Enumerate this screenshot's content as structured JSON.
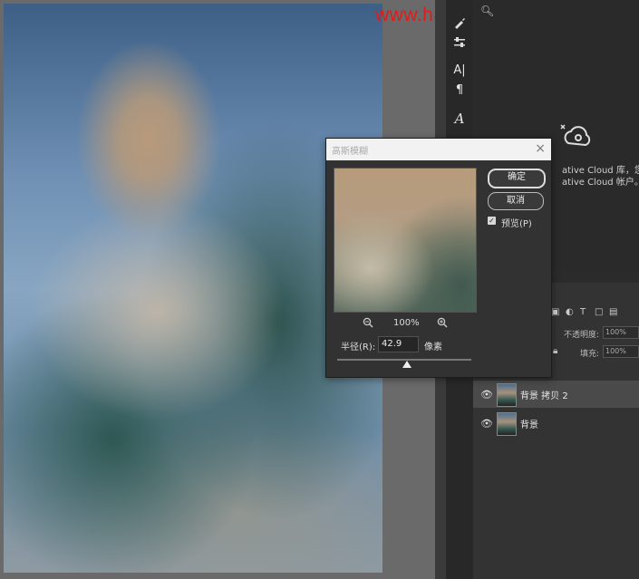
{
  "watermark": "www.haoyinhansheji.com",
  "dialog": {
    "title": "高斯模糊",
    "ok_label": "确定",
    "cancel_label": "取消",
    "preview_label": "预览(P)",
    "preview_checked": true,
    "zoom_level": "100%",
    "radius_label": "半径(R):",
    "radius_value": "42.9",
    "unit_label": "像素"
  },
  "cc_panel": {
    "line1": "ative Cloud 库，您需要",
    "line2": "ative Cloud 帐户。"
  },
  "layers_panel": {
    "opacity_label": "不透明度:",
    "opacity_value": "100%",
    "fill_label": "填充:",
    "fill_value": "100%",
    "layers": [
      {
        "name": "背景 拷贝 2",
        "active": true
      },
      {
        "name": "背景",
        "active": false
      }
    ]
  },
  "icons": {
    "search": "search-icon",
    "brush": "brush-icon",
    "sliders": "adjustment-sliders-icon",
    "character": "character-panel-icon",
    "paragraph": "paragraph-icon",
    "glyphs": "glyphs-icon",
    "cc_libraries": "creative-cloud-libraries-icon"
  }
}
